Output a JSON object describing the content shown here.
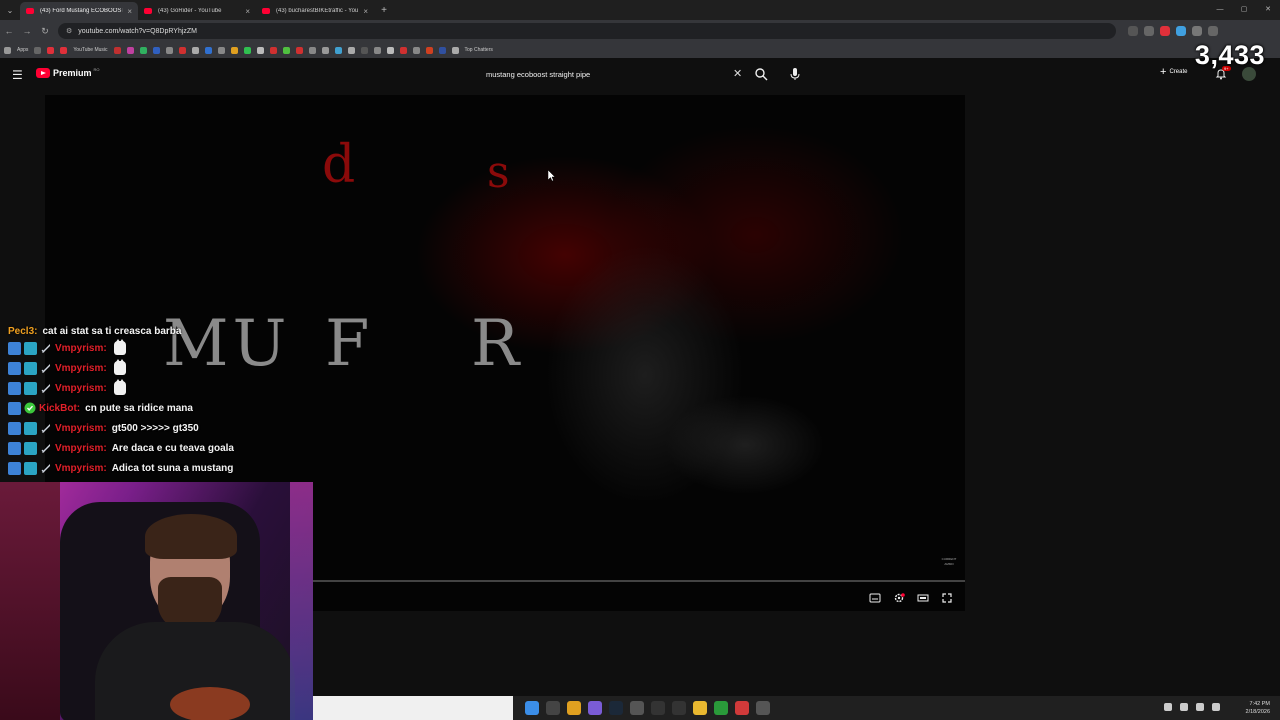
{
  "browser": {
    "tabs": [
      {
        "label": "(43) Ford Mustang ECOBOOST",
        "active": true
      },
      {
        "label": "(43) GoRider - YouTube",
        "active": false
      },
      {
        "label": "(43) bucharestBIKEtraffic - YouT",
        "active": false
      }
    ],
    "url": "youtube.com/watch?v=Q8DpRYhjzZM",
    "bookmarks": [
      "Apps",
      "YouTube Music",
      "Top Chatters"
    ]
  },
  "youtube": {
    "logo_text": "Premium",
    "region": "RO",
    "search_value": "mustang ecoboost straight pipe",
    "create_label": "Create",
    "notification_badge": "9+"
  },
  "stream": {
    "viewer_count": "3,433"
  },
  "video": {
    "overlay_red": [
      "d",
      "s"
    ],
    "overlay_grey": [
      "MU",
      "F",
      "R"
    ],
    "watermark": "CURRENT AMMO"
  },
  "chat": [
    {
      "user": "Pecl3",
      "color": "#f0a020",
      "message": "cat ai stat sa ti creasca barba",
      "badges": 0,
      "emote": false
    },
    {
      "user": "Vmpyrism",
      "color": "#e0202a",
      "message": "",
      "badges": 3,
      "emote": true
    },
    {
      "user": "Vmpyrism",
      "color": "#e0202a",
      "message": "",
      "badges": 3,
      "emote": true
    },
    {
      "user": "Vmpyrism",
      "color": "#e0202a",
      "message": "",
      "badges": 3,
      "emote": true
    },
    {
      "user": "KickBot",
      "color": "#e0202a",
      "message": "cn pute sa ridice mana",
      "badges": 2,
      "emote": false
    },
    {
      "user": "Vmpyrism",
      "color": "#e0202a",
      "message": "gt500 >>>>> gt350",
      "badges": 3,
      "emote": false
    },
    {
      "user": "Vmpyrism",
      "color": "#e0202a",
      "message": "Are daca e cu teava goala",
      "badges": 3,
      "emote": false
    },
    {
      "user": "Vmpyrism",
      "color": "#e0202a",
      "message": "Adica tot suna a mustang",
      "badges": 3,
      "emote": false
    }
  ],
  "taskbar": {
    "time": "7:42 PM",
    "date": "2/18/2026"
  },
  "colors": {
    "yt_red": "#ff0033",
    "chat_red": "#e0202a",
    "chat_orange": "#f0a020"
  }
}
